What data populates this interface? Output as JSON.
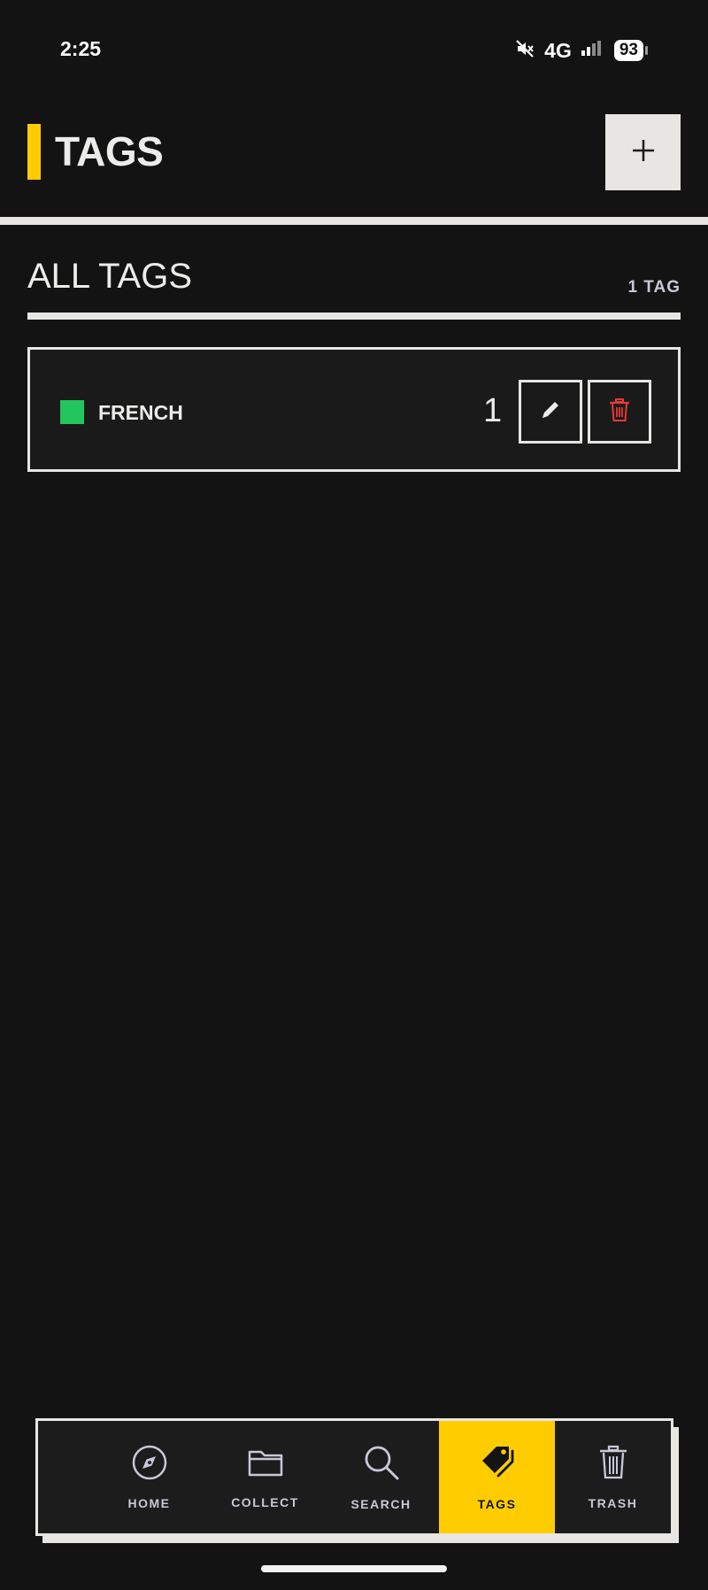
{
  "status_bar": {
    "time": "2:25",
    "network": "4G",
    "battery": "93"
  },
  "header": {
    "title": "TAGS",
    "accent_color": "#ffcc00",
    "add_icon": "plus-icon"
  },
  "section": {
    "title": "ALL TAGS",
    "count_label": "1 TAG"
  },
  "tags": [
    {
      "name": "FRENCH",
      "color": "#22c55e",
      "count": "1",
      "edit_icon": "pencil-icon",
      "delete_icon": "trash-icon",
      "delete_color": "#e53935"
    }
  ],
  "bottom_nav": {
    "items": [
      {
        "label": "HOME",
        "icon": "compass-icon",
        "active": false
      },
      {
        "label": "COLLECT",
        "icon": "folder-icon",
        "active": false
      },
      {
        "label": "SEARCH",
        "icon": "search-icon",
        "active": false
      },
      {
        "label": "TAGS",
        "icon": "tag-icon",
        "active": true
      },
      {
        "label": "TRASH",
        "icon": "trash-icon",
        "active": false
      }
    ]
  }
}
